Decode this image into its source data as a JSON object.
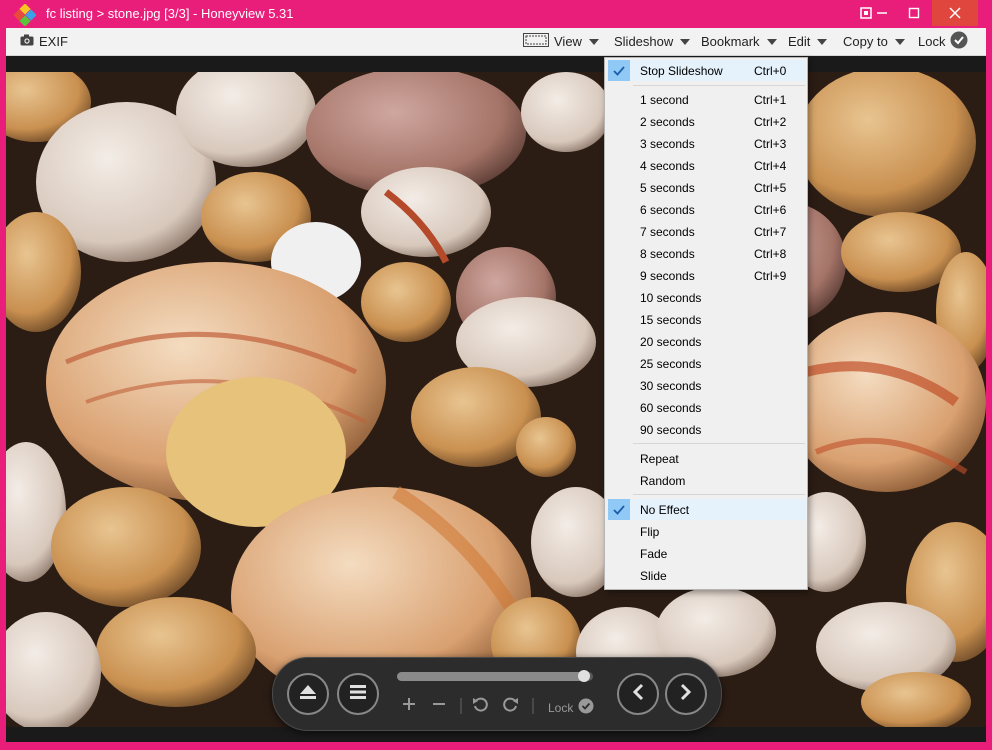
{
  "window": {
    "title": "fc listing > stone.jpg [3/3] - Honeyview 5.31",
    "accent_color": "#e91e7a",
    "close_color": "#e0463e"
  },
  "toolbar": {
    "exif_label": "EXIF",
    "view_label": "View",
    "slideshow_label": "Slideshow",
    "bookmark_label": "Bookmark",
    "edit_label": "Edit",
    "copyto_label": "Copy to",
    "lock_label": "Lock"
  },
  "slideshow_menu": {
    "stop": {
      "label": "Stop Slideshow",
      "shortcut": "Ctrl+0",
      "checked": true
    },
    "intervals": [
      {
        "label": "1 second",
        "shortcut": "Ctrl+1"
      },
      {
        "label": "2 seconds",
        "shortcut": "Ctrl+2"
      },
      {
        "label": "3 seconds",
        "shortcut": "Ctrl+3"
      },
      {
        "label": "4 seconds",
        "shortcut": "Ctrl+4"
      },
      {
        "label": "5 seconds",
        "shortcut": "Ctrl+5"
      },
      {
        "label": "6 seconds",
        "shortcut": "Ctrl+6"
      },
      {
        "label": "7 seconds",
        "shortcut": "Ctrl+7"
      },
      {
        "label": "8 seconds",
        "shortcut": "Ctrl+8"
      },
      {
        "label": "9 seconds",
        "shortcut": "Ctrl+9"
      },
      {
        "label": "10 seconds",
        "shortcut": ""
      },
      {
        "label": "15 seconds",
        "shortcut": ""
      },
      {
        "label": "20 seconds",
        "shortcut": ""
      },
      {
        "label": "25 seconds",
        "shortcut": ""
      },
      {
        "label": "30 seconds",
        "shortcut": ""
      },
      {
        "label": "60 seconds",
        "shortcut": ""
      },
      {
        "label": "90 seconds",
        "shortcut": ""
      }
    ],
    "order": [
      {
        "label": "Repeat"
      },
      {
        "label": "Random"
      }
    ],
    "effects": [
      {
        "label": "No Effect",
        "checked": true
      },
      {
        "label": "Flip",
        "checked": false
      },
      {
        "label": "Fade",
        "checked": false
      },
      {
        "label": "Slide",
        "checked": false
      }
    ]
  },
  "hud": {
    "lock_label": "Lock",
    "seek_progress": 0.97
  }
}
